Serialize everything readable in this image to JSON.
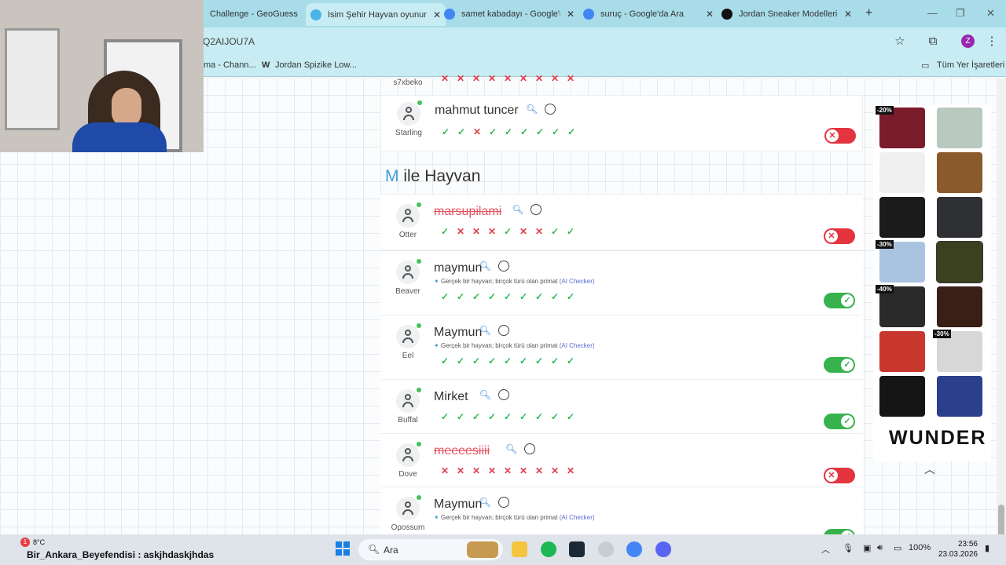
{
  "browser": {
    "tabs": [
      {
        "title": "Challenge - GeoGuess",
        "favicon_color": "#3a7bd5"
      },
      {
        "title": "İsim Şehir Hayvan oyunun",
        "favicon_color": "#4ab3e8",
        "active": true
      },
      {
        "title": "samet kabadayı - Google'd",
        "favicon_color": "#4285f4"
      },
      {
        "title": "suruç - Google'da Ara",
        "favicon_color": "#4285f4"
      },
      {
        "title": "Jordan Sneaker Modelleri",
        "favicon_color": "#111111"
      }
    ],
    "url": "Q2AIJOU7A",
    "profile_initial": "Z",
    "bookmarks": [
      {
        "label": "ma - Chann..."
      },
      {
        "label": "Jordan Spizike Low..."
      }
    ],
    "all_bookmarks": "Tüm Yer İşaretleri"
  },
  "game": {
    "prev_row": {
      "player": "s7xbeko",
      "marks": [
        "no",
        "no",
        "no",
        "no",
        "no",
        "no",
        "no",
        "no",
        "no"
      ]
    },
    "top_row": {
      "word": "mahmut tuncer",
      "player": "Starling",
      "rejected": false,
      "marks": [
        "ok",
        "ok",
        "no",
        "ok",
        "ok",
        "ok",
        "ok",
        "ok",
        "ok"
      ],
      "toggle": "off"
    },
    "section": {
      "letter": "M",
      "title": "ile Hayvan"
    },
    "rows": [
      {
        "word": "marsupilami",
        "player": "Otter",
        "rejected": true,
        "note": "",
        "marks": [
          "ok",
          "no",
          "no",
          "no",
          "ok",
          "no",
          "no",
          "ok",
          "ok"
        ],
        "toggle": "off"
      },
      {
        "word": "maymun",
        "player": "Beaver",
        "rejected": false,
        "note": "Gerçek bir hayvan; birçok türü olan primat",
        "marks": [
          "ok",
          "ok",
          "ok",
          "ok",
          "ok",
          "ok",
          "ok",
          "ok",
          "ok"
        ],
        "toggle": "on"
      },
      {
        "word": "Maymun",
        "player": "Eel",
        "rejected": false,
        "note": "Gerçek bir hayvan; birçok türü olan primat",
        "marks": [
          "ok",
          "ok",
          "ok",
          "ok",
          "ok",
          "ok",
          "ok",
          "ok",
          "ok"
        ],
        "toggle": "on"
      },
      {
        "word": "Mirket",
        "player": "Buffal",
        "rejected": false,
        "note": "",
        "marks": [
          "ok",
          "ok",
          "ok",
          "ok",
          "ok",
          "ok",
          "ok",
          "ok",
          "ok"
        ],
        "toggle": "on"
      },
      {
        "word": "meeeesiiii",
        "player": "Dove",
        "rejected": true,
        "note": "",
        "marks": [
          "no",
          "no",
          "no",
          "no",
          "no",
          "no",
          "no",
          "no",
          "no"
        ],
        "toggle": "off"
      },
      {
        "word": "Maymun",
        "player": "Opossum",
        "rejected": false,
        "note": "Gerçek bir hayvan; birçok türü olan primat",
        "marks": [],
        "toggle": "on"
      }
    ],
    "ai_checker": "(AI Checker)"
  },
  "ad": {
    "brand": "WUNDER",
    "products": [
      {
        "name": "maroon jacket",
        "color": "#7a1c2c",
        "discount": "-20%"
      },
      {
        "name": "sneaker",
        "color": "#b9c9c0",
        "discount": ""
      },
      {
        "name": "white tee",
        "color": "#f0f0f0",
        "discount": ""
      },
      {
        "name": "brown pants",
        "color": "#8a5a2b",
        "discount": ""
      },
      {
        "name": "black hoodie",
        "color": "#1b1b1b",
        "discount": ""
      },
      {
        "name": "camo hoodie",
        "color": "#2e3033",
        "discount": ""
      },
      {
        "name": "blue sneaker",
        "color": "#a9c4e0",
        "discount": "-30%"
      },
      {
        "name": "olive hoodie",
        "color": "#3b4020",
        "discount": ""
      },
      {
        "name": "black puffer",
        "color": "#2a2a2a",
        "discount": "-40%"
      },
      {
        "name": "brown hoodie",
        "color": "#3a1f16",
        "discount": ""
      },
      {
        "name": "red sneaker",
        "color": "#c8372d",
        "discount": ""
      },
      {
        "name": "grey sneaker",
        "color": "#d7d7d7",
        "discount": "-30%"
      },
      {
        "name": "black jacket",
        "color": "#151515",
        "discount": ""
      },
      {
        "name": "blue hoodie",
        "color": "#2c3f8c",
        "discount": ""
      }
    ]
  },
  "taskbar": {
    "temperature": "8°C",
    "badge": "1",
    "chat_user": "Bir_Ankara_Beyefendisi",
    "chat_message": ": askjhdaskjhdas",
    "search_label": "Ara",
    "battery": "100%",
    "time": "23:56",
    "date": "23.03.2026"
  }
}
